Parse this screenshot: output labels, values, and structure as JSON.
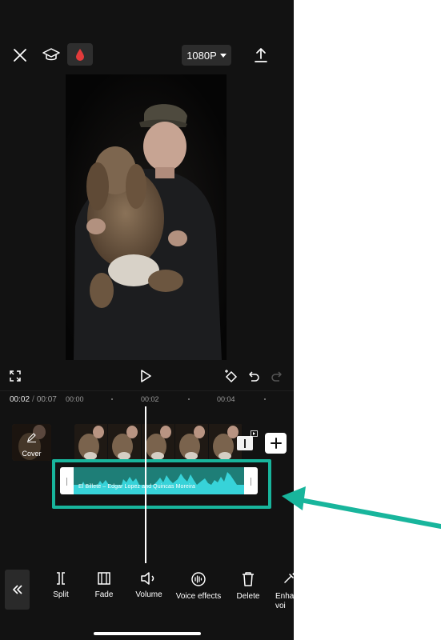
{
  "header": {
    "resolution_label": "1080P"
  },
  "timeline": {
    "current_time": "00:02",
    "separator": "/",
    "total_time": "00:07",
    "ruler_labels": [
      "00:00",
      "00:02",
      "00:04"
    ],
    "cover_label": "Cover",
    "audio_title": "El Billete – Edgar Lopez and Quincas Moreira"
  },
  "toolbar": {
    "items": [
      {
        "label": "Split",
        "icon": "split-icon"
      },
      {
        "label": "Fade",
        "icon": "fade-icon"
      },
      {
        "label": "Volume",
        "icon": "volume-icon"
      },
      {
        "label": "Voice effects",
        "icon": "voice-effects-icon"
      },
      {
        "label": "Delete",
        "icon": "delete-icon"
      },
      {
        "label": "Enha\nvoi",
        "icon": "enhance-voice-icon"
      }
    ]
  },
  "colors": {
    "highlight": "#18b59c",
    "audio_track": "#1e7e77",
    "waveform": "#37d3d9",
    "effect_drop": "#e23b3b"
  }
}
